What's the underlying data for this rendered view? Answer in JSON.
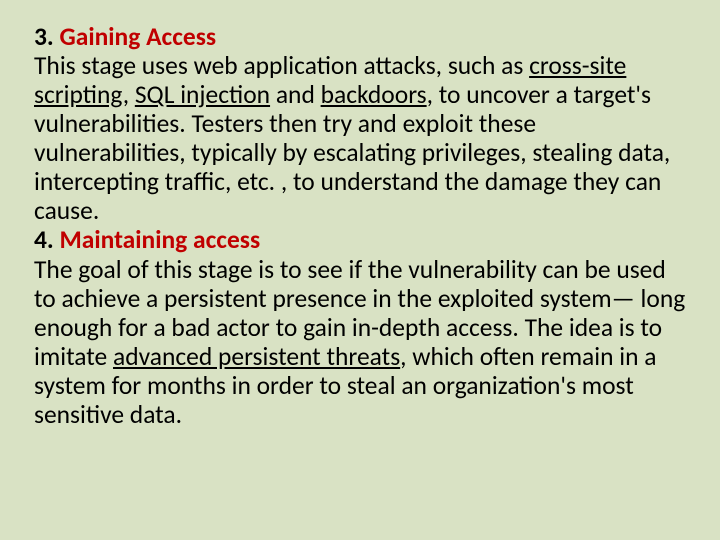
{
  "section3": {
    "number": "3. ",
    "title": "Gaining Access",
    "body_a": "This stage uses web application attacks, such as ",
    "link1": "cross-site scripting",
    "sep1": ", ",
    "link2": "SQL injection",
    "sep2": " and ",
    "link3": "backdoors",
    "body_b": ", to uncover a target's vulnerabilities. Testers then try and exploit these vulnerabilities, typically by escalating privileges, stealing data, intercepting traffic, etc. , to understand the damage they can cause."
  },
  "section4": {
    "number": "4. ",
    "title": "Maintaining access",
    "body_a": "The goal of this stage is to see if the vulnerability can be used to achieve a persistent presence in the exploited system— long enough for a bad actor to gain in-depth access. The idea is to imitate ",
    "link1": "advanced persistent threats",
    "body_b": ", which often remain in a system for months in order to steal an organization's most sensitive data."
  }
}
